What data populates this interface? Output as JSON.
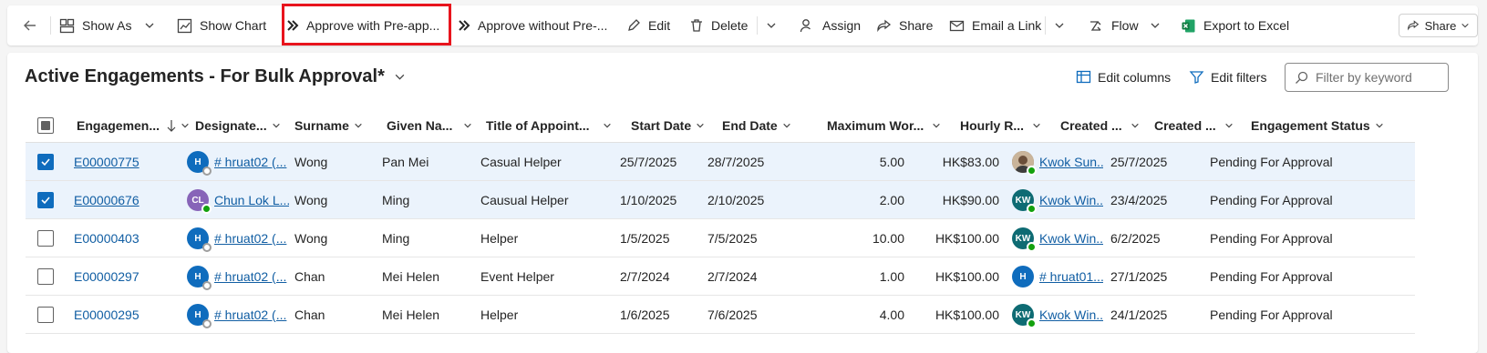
{
  "toolbar": {
    "items": [
      {
        "label": "Show As",
        "icon": "show-as-icon"
      },
      {
        "label": "Show Chart",
        "icon": "chart-icon"
      },
      {
        "label": "Approve with Pre-app...",
        "icon": "double-chevron-icon"
      },
      {
        "label": "Approve without Pre-...",
        "icon": "double-chevron-icon"
      },
      {
        "label": "Edit",
        "icon": "pencil-icon"
      },
      {
        "label": "Delete",
        "icon": "trash-icon"
      },
      {
        "label": "Assign",
        "icon": "person-icon"
      },
      {
        "label": "Share",
        "icon": "share-icon"
      },
      {
        "label": "Email a Link",
        "icon": "email-link-icon"
      },
      {
        "label": "Flow",
        "icon": "flow-icon"
      },
      {
        "label": "Export to Excel",
        "icon": "excel-icon"
      }
    ],
    "share_button": "Share"
  },
  "view": {
    "title": "Active Engagements - For Bulk Approval*",
    "edit_columns": "Edit columns",
    "edit_filters": "Edit filters",
    "filter_placeholder": "Filter by keyword"
  },
  "columns": [
    "Engagemen...",
    "Designate...",
    "Surname",
    "Given Na...",
    "Title of Appoint...",
    "Start Date",
    "End Date",
    "Maximum Wor...",
    "Hourly R...",
    "Created ...",
    "Created ...",
    "Engagement Status"
  ],
  "rows": [
    {
      "selected": true,
      "id": "E00000775",
      "designate": "# hruat02 (...",
      "designate_initials": "H",
      "designate_color": "#0f6cbd",
      "designate_presence": "off",
      "surname": "Wong",
      "given": "Pan Mei",
      "title": "Casual Helper",
      "start": "25/7/2025",
      "end": "28/7/2025",
      "max": "5.00",
      "rate": "HK$83.00",
      "creator": "Kwok Sun...",
      "creator_initials": "",
      "creator_color": "#8a6a4a",
      "creator_photo": true,
      "created": "25/7/2025",
      "status": "Pending For Approval"
    },
    {
      "selected": true,
      "id": "E00000676",
      "designate": "Chun Lok L...",
      "designate_initials": "CL",
      "designate_color": "#8764b8",
      "designate_presence": "on",
      "surname": "Wong",
      "given": "Ming",
      "title": "Causual Helper",
      "start": "1/10/2025",
      "end": "2/10/2025",
      "max": "2.00",
      "rate": "HK$90.00",
      "creator": "Kwok Win...",
      "creator_initials": "KW",
      "creator_color": "#0e6b73",
      "creator_photo": false,
      "created": "23/4/2025",
      "status": "Pending For Approval"
    },
    {
      "selected": false,
      "id": "E00000403",
      "designate": "# hruat02 (...",
      "designate_initials": "H",
      "designate_color": "#0f6cbd",
      "designate_presence": "off",
      "surname": "Wong",
      "given": "Ming",
      "title": "Helper",
      "start": "1/5/2025",
      "end": "7/5/2025",
      "max": "10.00",
      "rate": "HK$100.00",
      "creator": "Kwok Win...",
      "creator_initials": "KW",
      "creator_color": "#0e6b73",
      "creator_photo": false,
      "created": "6/2/2025",
      "status": "Pending For Approval"
    },
    {
      "selected": false,
      "id": "E00000297",
      "designate": "# hruat02 (...",
      "designate_initials": "H",
      "designate_color": "#0f6cbd",
      "designate_presence": "off",
      "surname": "Chan",
      "given": "Mei Helen",
      "title": "Event Helper",
      "start": "2/7/2024",
      "end": "2/7/2024",
      "max": "1.00",
      "rate": "HK$100.00",
      "creator": "# hruat01...",
      "creator_initials": "H",
      "creator_color": "#0f6cbd",
      "creator_photo": false,
      "created": "27/1/2025",
      "status": "Pending For Approval"
    },
    {
      "selected": false,
      "id": "E00000295",
      "designate": "# hruat02 (...",
      "designate_initials": "H",
      "designate_color": "#0f6cbd",
      "designate_presence": "off",
      "surname": "Chan",
      "given": "Mei Helen",
      "title": "Helper",
      "start": "1/6/2025",
      "end": "7/6/2025",
      "max": "4.00",
      "rate": "HK$100.00",
      "creator": "Kwok Win...",
      "creator_initials": "KW",
      "creator_color": "#0e6b73",
      "creator_photo": false,
      "created": "24/1/2025",
      "status": "Pending For Approval"
    }
  ],
  "colors": {
    "accent": "#0f6cbd",
    "highlight_box": "#e8141d",
    "selected_row": "#ebf3fc",
    "presence_available": "#13a10e"
  }
}
